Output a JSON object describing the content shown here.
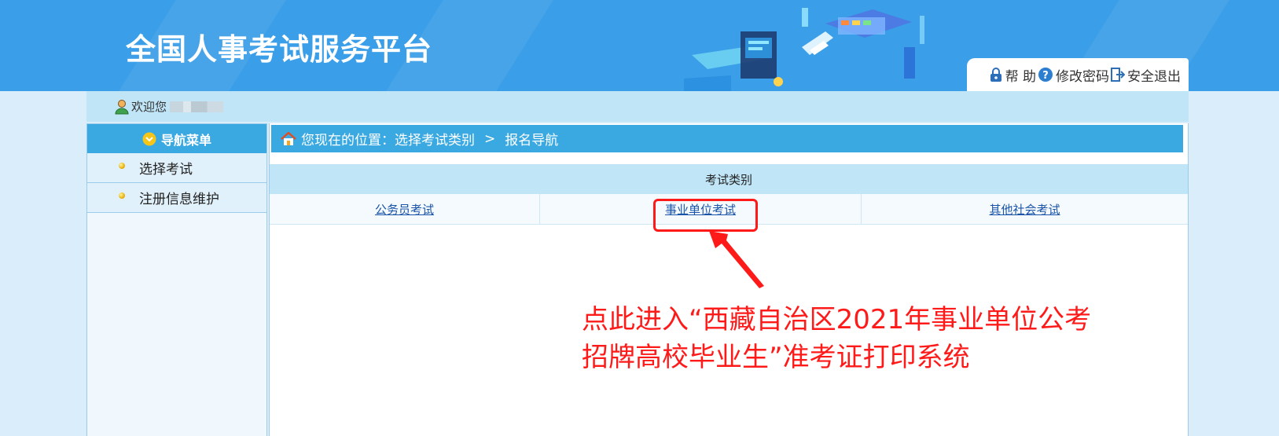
{
  "header": {
    "site_title": "全国人事考试服务平台",
    "toolbar": {
      "help": "帮 助",
      "change_password": "修改密码",
      "logout": "安全退出"
    }
  },
  "welcome": {
    "label": "欢迎您"
  },
  "sidebar": {
    "title": "导航菜单",
    "items": [
      {
        "label": "选择考试"
      },
      {
        "label": "注册信息维护"
      }
    ]
  },
  "breadcrumb": {
    "prefix": "您现在的位置：",
    "path": [
      "选择考试类别",
      "报名导航"
    ],
    "separator": ">"
  },
  "exam_categories": {
    "header": "考试类别",
    "items": [
      {
        "label": "公务员考试"
      },
      {
        "label": "事业单位考试"
      },
      {
        "label": "其他社会考试"
      }
    ]
  },
  "annotation": {
    "line1": "点此进入“西藏自治区2021年事业单位公考",
    "line2": "招牌高校毕业生”准考证打印系统"
  },
  "colors": {
    "header_blue": "#3a9ee8",
    "nav_blue": "#3aa9e1",
    "annotation_red": "#ff1a1a",
    "link_blue": "#1a54a8"
  }
}
